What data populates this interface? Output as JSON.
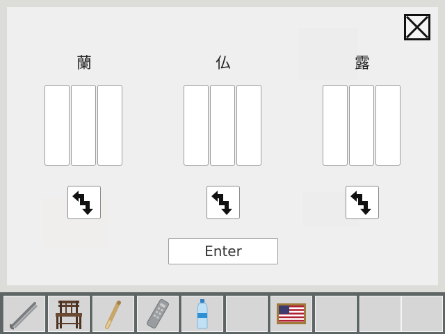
{
  "puzzle": {
    "columns": [
      {
        "character": "蘭"
      },
      {
        "character": "仏"
      },
      {
        "character": "露"
      }
    ],
    "swap_icon": "swap-arrows-icon",
    "enter_label": "Enter",
    "close_icon": "close-x-icon"
  },
  "inventory": {
    "slots": [
      {
        "item": "tongs-icon"
      },
      {
        "item": "wooden-chair-icon"
      },
      {
        "item": "thermometer-icon"
      },
      {
        "item": "remote-control-icon"
      },
      {
        "item": "water-bottle-icon"
      },
      {
        "item": ""
      },
      {
        "item": "us-flag-icon"
      },
      {
        "item": ""
      },
      {
        "item": ""
      },
      {
        "item": ""
      }
    ]
  }
}
